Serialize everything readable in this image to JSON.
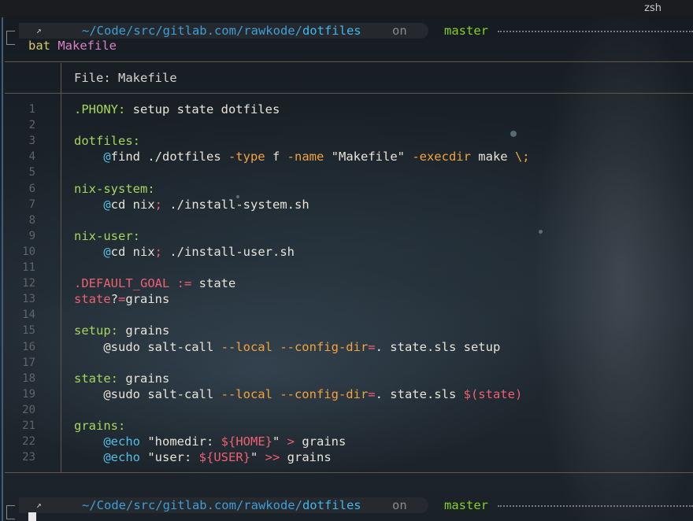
{
  "window": {
    "tab_title": "zsh"
  },
  "prompt": {
    "arrow": "↗",
    "path_prefix": "~/Code/src/gitlab.com/rawkode/",
    "path_dir": "dotfiles",
    "on": "on",
    "branch": "master"
  },
  "command": {
    "program": "bat",
    "argument": "Makefile"
  },
  "file_header": "File: Makefile",
  "colors": {
    "accent_path": "#3d9fd9",
    "branch": "#86d01f",
    "target": "#a6d65a",
    "keyword": "#f5a23a",
    "variable": "#ef6071"
  },
  "code_lines": [
    {
      "n": "1",
      "t": [
        {
          "s": "tgt",
          "v": ".PHONY:"
        },
        {
          "s": "pl",
          "v": " setup state dotfiles"
        }
      ]
    },
    {
      "n": "2",
      "t": []
    },
    {
      "n": "3",
      "t": [
        {
          "s": "tgt",
          "v": "dotfiles:"
        }
      ]
    },
    {
      "n": "4",
      "t": [
        {
          "s": "pl",
          "v": "    "
        },
        {
          "s": "at",
          "v": "@"
        },
        {
          "s": "pl",
          "v": "find ./dotfiles "
        },
        {
          "s": "kw",
          "v": "-type"
        },
        {
          "s": "pl",
          "v": " f "
        },
        {
          "s": "kw",
          "v": "-name"
        },
        {
          "s": "pl",
          "v": " \"Makefile\" "
        },
        {
          "s": "kw",
          "v": "-execdir"
        },
        {
          "s": "pl",
          "v": " make "
        },
        {
          "s": "kw",
          "v": "\\;"
        }
      ]
    },
    {
      "n": "5",
      "t": []
    },
    {
      "n": "6",
      "t": [
        {
          "s": "tgt",
          "v": "nix-system:"
        }
      ]
    },
    {
      "n": "7",
      "t": [
        {
          "s": "pl",
          "v": "    "
        },
        {
          "s": "at",
          "v": "@"
        },
        {
          "s": "pl",
          "v": "cd nix"
        },
        {
          "s": "var",
          "v": ";"
        },
        {
          "s": "pl",
          "v": " ./install-system.sh"
        }
      ]
    },
    {
      "n": "8",
      "t": []
    },
    {
      "n": "9",
      "t": [
        {
          "s": "tgt",
          "v": "nix-user:"
        }
      ]
    },
    {
      "n": "10",
      "t": [
        {
          "s": "pl",
          "v": "    "
        },
        {
          "s": "at",
          "v": "@"
        },
        {
          "s": "pl",
          "v": "cd nix"
        },
        {
          "s": "var",
          "v": ";"
        },
        {
          "s": "pl",
          "v": " ./install-user.sh"
        }
      ]
    },
    {
      "n": "11",
      "t": []
    },
    {
      "n": "12",
      "t": [
        {
          "s": "var",
          "v": ".DEFAULT_GOAL"
        },
        {
          "s": "pl",
          "v": " "
        },
        {
          "s": "var",
          "v": ":="
        },
        {
          "s": "pl",
          "v": " state"
        }
      ]
    },
    {
      "n": "13",
      "t": [
        {
          "s": "var",
          "v": "state"
        },
        {
          "s": "pl",
          "v": "?"
        },
        {
          "s": "var",
          "v": "="
        },
        {
          "s": "pl",
          "v": "grains"
        }
      ]
    },
    {
      "n": "14",
      "t": []
    },
    {
      "n": "15",
      "t": [
        {
          "s": "tgt",
          "v": "setup:"
        },
        {
          "s": "pl",
          "v": " grains"
        }
      ]
    },
    {
      "n": "16",
      "t": [
        {
          "s": "pl",
          "v": "    @sudo salt-call "
        },
        {
          "s": "kw",
          "v": "--local"
        },
        {
          "s": "pl",
          "v": " "
        },
        {
          "s": "kw",
          "v": "--config-dir"
        },
        {
          "s": "var",
          "v": "="
        },
        {
          "s": "pl",
          "v": ". state.sls setup"
        }
      ]
    },
    {
      "n": "17",
      "t": []
    },
    {
      "n": "18",
      "t": [
        {
          "s": "tgt",
          "v": "state:"
        },
        {
          "s": "pl",
          "v": " grains"
        }
      ]
    },
    {
      "n": "19",
      "t": [
        {
          "s": "pl",
          "v": "    @sudo salt-call "
        },
        {
          "s": "kw",
          "v": "--local"
        },
        {
          "s": "pl",
          "v": " "
        },
        {
          "s": "kw",
          "v": "--config-dir"
        },
        {
          "s": "var",
          "v": "="
        },
        {
          "s": "pl",
          "v": ". state.sls "
        },
        {
          "s": "var",
          "v": "$(state)"
        }
      ]
    },
    {
      "n": "20",
      "t": []
    },
    {
      "n": "21",
      "t": [
        {
          "s": "tgt",
          "v": "grains:"
        }
      ]
    },
    {
      "n": "22",
      "t": [
        {
          "s": "pl",
          "v": "    "
        },
        {
          "s": "at",
          "v": "@echo"
        },
        {
          "s": "pl",
          "v": " \"homedir: "
        },
        {
          "s": "var",
          "v": "${HOME}"
        },
        {
          "s": "pl",
          "v": "\" "
        },
        {
          "s": "var",
          "v": ">"
        },
        {
          "s": "pl",
          "v": " grains"
        }
      ]
    },
    {
      "n": "23",
      "t": [
        {
          "s": "pl",
          "v": "    "
        },
        {
          "s": "at",
          "v": "@echo"
        },
        {
          "s": "pl",
          "v": " \"user: "
        },
        {
          "s": "var",
          "v": "${USER}"
        },
        {
          "s": "pl",
          "v": "\" "
        },
        {
          "s": "var",
          "v": ">>"
        },
        {
          "s": "pl",
          "v": " grains"
        }
      ]
    }
  ]
}
